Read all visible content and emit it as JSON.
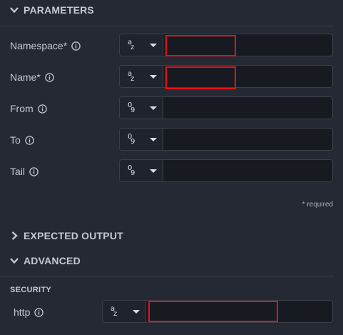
{
  "sections": {
    "parameters": "PARAMETERS",
    "expected_output": "EXPECTED OUTPUT",
    "advanced": "ADVANCED"
  },
  "parameters": {
    "fields": [
      {
        "label": "Namespace*",
        "type_top": "a",
        "type_bottom": "z",
        "value": ""
      },
      {
        "label": "Name*",
        "type_top": "a",
        "type_bottom": "z",
        "value": ""
      },
      {
        "label": "From",
        "type_top": "0",
        "type_bottom": "9",
        "value": ""
      },
      {
        "label": "To",
        "type_top": "0",
        "type_bottom": "9",
        "value": ""
      },
      {
        "label": "Tail",
        "type_top": "0",
        "type_bottom": "9",
        "value": ""
      }
    ],
    "required_note": "* required"
  },
  "advanced": {
    "security_heading": "SECURITY",
    "http": {
      "label": "http",
      "type_top": "a",
      "type_bottom": "z",
      "value": ""
    }
  },
  "colors": {
    "background": "#252933",
    "input_bg": "#171a21",
    "highlight": "#e0141c"
  }
}
